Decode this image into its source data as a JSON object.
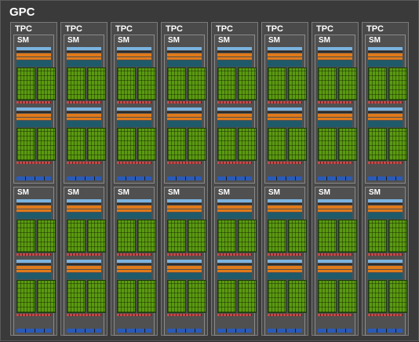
{
  "gpc_label": "GPC",
  "tpc_label": "TPC",
  "sm_label": "SM",
  "tpc_count": 8,
  "sms_per_tpc": 2,
  "colors": {
    "background": "#3a3a3a",
    "tpc": "#4a4a4a",
    "sm": "#505050",
    "l1": "#7ab3e0",
    "dispatch": "#e07a1a",
    "register": "#1f5a6a",
    "core": "#5a9a10",
    "sfu": "#c24a4a",
    "texture": "#2a5ab8"
  }
}
